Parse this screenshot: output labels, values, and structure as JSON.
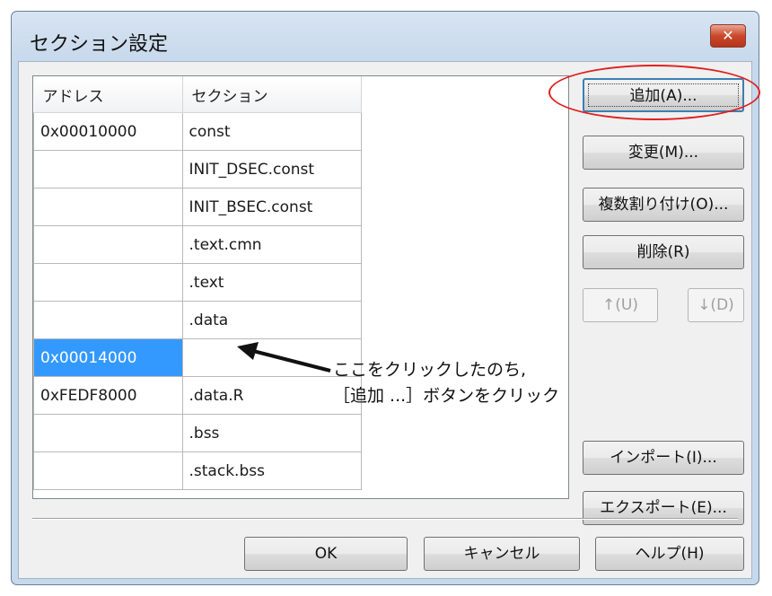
{
  "dialog": {
    "title": "セクション設定",
    "close_label": "✕"
  },
  "table": {
    "headers": [
      "アドレス",
      "セクション"
    ],
    "rows": [
      {
        "address": "0x00010000",
        "section": "const"
      },
      {
        "address": "",
        "section": "INIT_DSEC.const"
      },
      {
        "address": "",
        "section": "INIT_BSEC.const"
      },
      {
        "address": "",
        "section": ".text.cmn"
      },
      {
        "address": "",
        "section": ".text"
      },
      {
        "address": "",
        "section": ".data"
      },
      {
        "address": "0x00014000",
        "section": ""
      },
      {
        "address": "0xFEDF8000",
        "section": ".data.R"
      },
      {
        "address": "",
        "section": ".bss"
      },
      {
        "address": "",
        "section": ".stack.bss"
      }
    ],
    "selected_row": 6
  },
  "buttons": {
    "add": "追加(A)...",
    "change": "変更(M)...",
    "multi_assign": "複数割り付け(O)...",
    "delete": "削除(R)",
    "up": "↑(U)",
    "down": "↓(D)",
    "import": "インポート(I)...",
    "export": "エクスポート(E)...",
    "ok": "OK",
    "cancel": "キャンセル",
    "help": "ヘルプ(H)"
  },
  "annotation": {
    "line1": "ここをクリックしたのち,",
    "line2": "［追加 ...］ボタンをクリック",
    "highlight_color": "#e02020"
  },
  "colors": {
    "selection": "#3399ff",
    "title_bar": "#c6d8ec"
  }
}
